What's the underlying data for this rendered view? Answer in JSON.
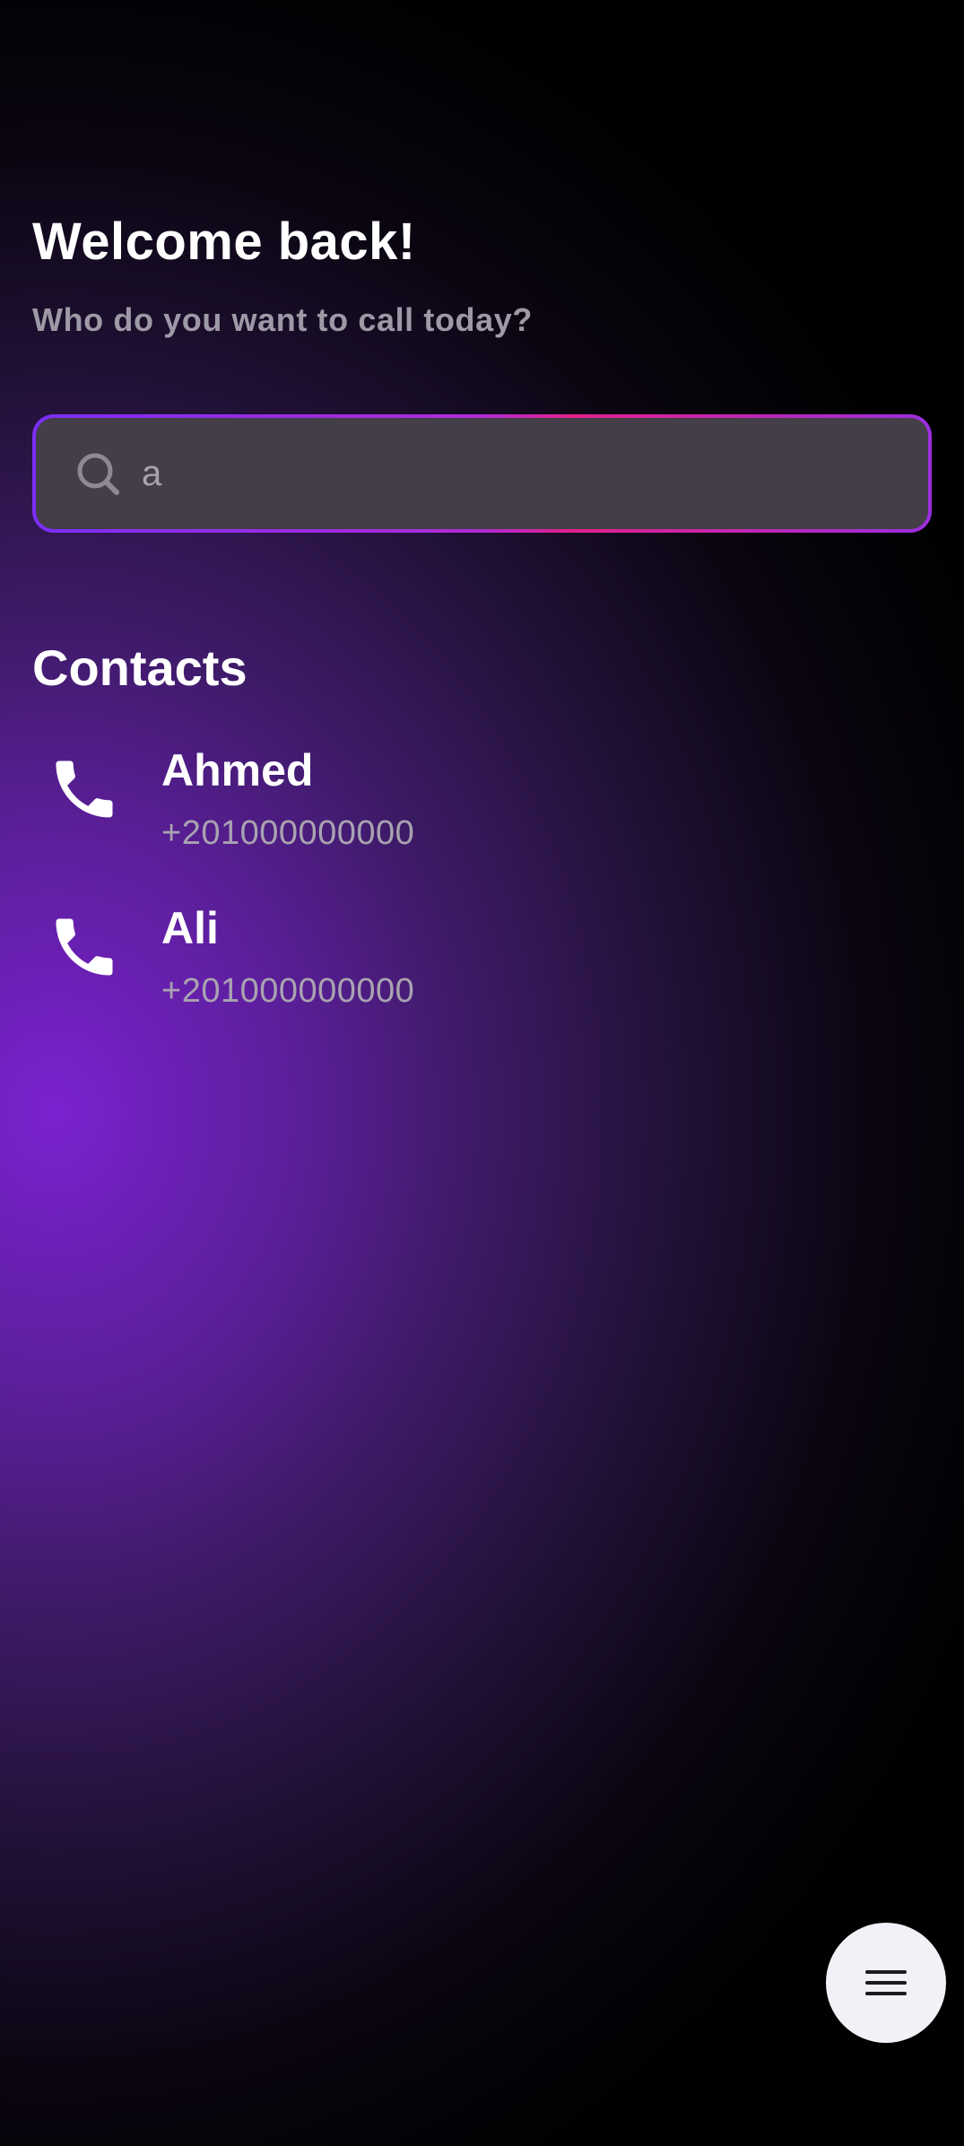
{
  "header": {
    "greeting": "Welcome back!",
    "subtitle": "Who do you want to call today?"
  },
  "search": {
    "value": "a",
    "icon": "search-icon",
    "border_colors": [
      "#7b2ff7",
      "#e3208c"
    ]
  },
  "contacts": {
    "title": "Contacts",
    "items": [
      {
        "name": "Ahmed",
        "number": "+201000000000",
        "icon": "phone-icon"
      },
      {
        "name": "Ali",
        "number": "+201000000000",
        "icon": "phone-icon"
      }
    ]
  },
  "fab": {
    "icon": "menu-icon"
  },
  "colors": {
    "accent": "#7a22d0",
    "background": "#000000",
    "text_primary": "#ffffff",
    "text_secondary": "#9e99a6"
  }
}
